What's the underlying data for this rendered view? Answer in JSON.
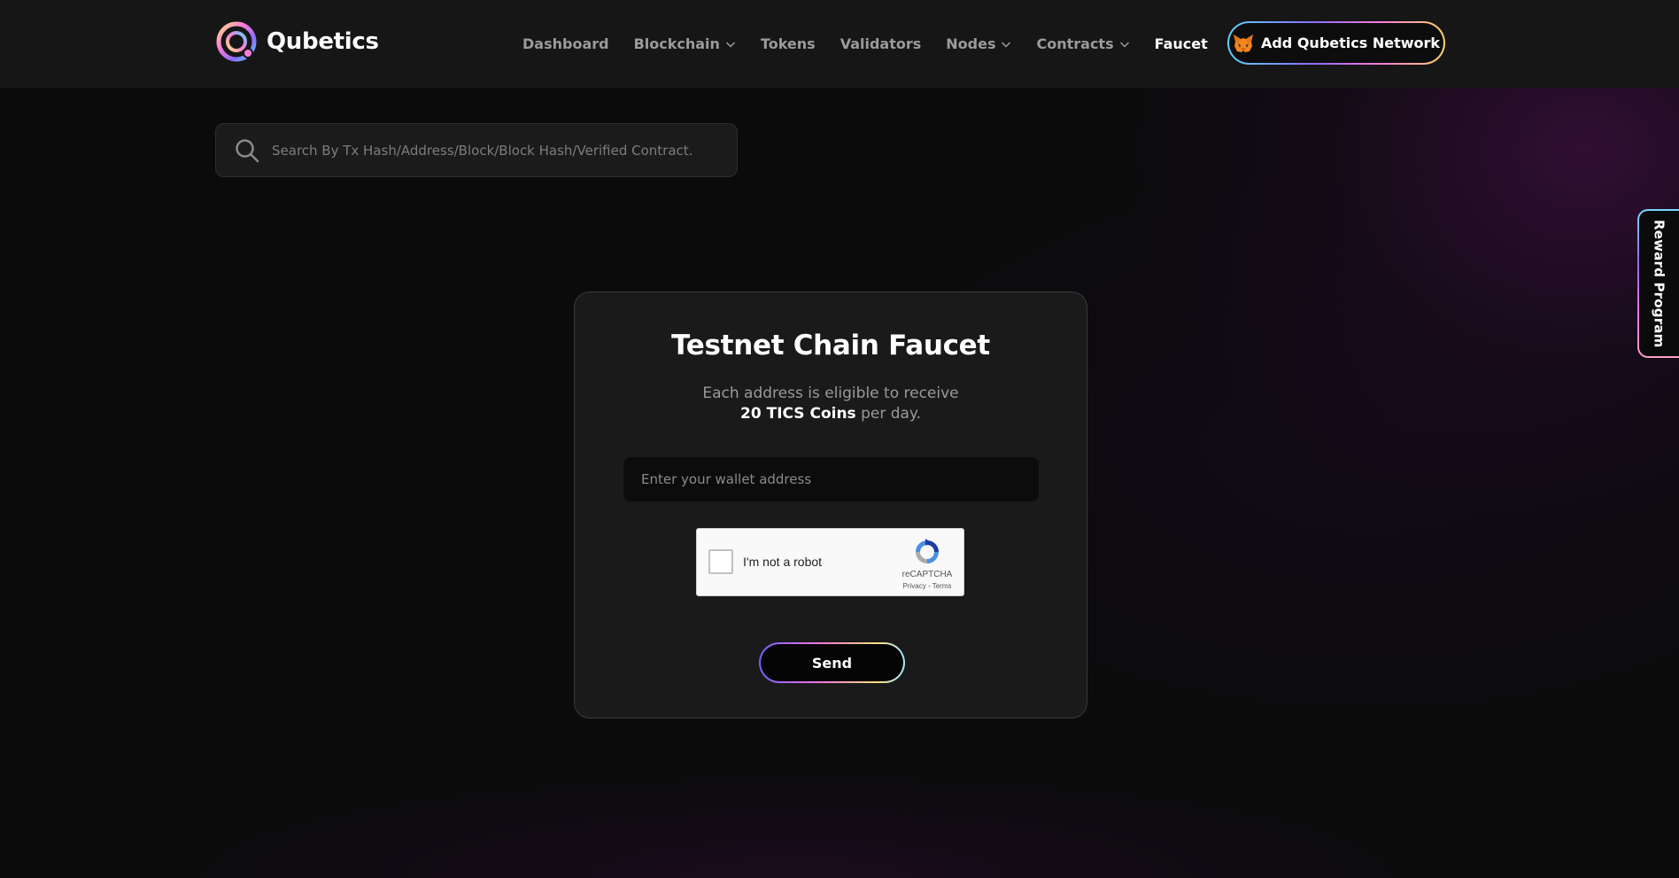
{
  "header": {
    "brand": "Qubetics",
    "nav": [
      {
        "label": "Dashboard",
        "dropdown": false,
        "active": false
      },
      {
        "label": "Blockchain",
        "dropdown": true,
        "active": false
      },
      {
        "label": "Tokens",
        "dropdown": false,
        "active": false
      },
      {
        "label": "Validators",
        "dropdown": false,
        "active": false
      },
      {
        "label": "Nodes",
        "dropdown": true,
        "active": false
      },
      {
        "label": "Contracts",
        "dropdown": true,
        "active": false
      },
      {
        "label": "Faucet",
        "dropdown": false,
        "active": true
      }
    ],
    "add_network_label": "Add Qubetics Network"
  },
  "search": {
    "placeholder": "Search By Tx Hash/Address/Block/Block Hash/Verified Contract."
  },
  "faucet": {
    "title": "Testnet Chain Faucet",
    "subtitle_line1": "Each address is eligible to receive",
    "amount": "20 TICS Coins",
    "subtitle_suffix": " per day.",
    "wallet_placeholder": "Enter your wallet address",
    "captcha": {
      "label": "I'm not a robot",
      "brand": "reCAPTCHA",
      "links": "Privacy - Terms",
      "checked": false
    },
    "send_label": "Send"
  },
  "reward_tab": {
    "label": "Reward Program"
  },
  "colors": {
    "background": "#0b0b0c",
    "header": "#161616",
    "card": "#1a1a1b",
    "nav_inactive": "#9b9b9b",
    "nav_active": "#ffffff",
    "accent_gradient": [
      "#5ad1ff",
      "#8b6cff",
      "#ff7ad9",
      "#ffd36b"
    ]
  },
  "icons": {
    "logo": "qubetics-logo-icon",
    "search": "search-icon",
    "dropdown": "chevron-down-icon",
    "wallet": "metamask-fox-icon",
    "captcha": "recaptcha-icon"
  }
}
